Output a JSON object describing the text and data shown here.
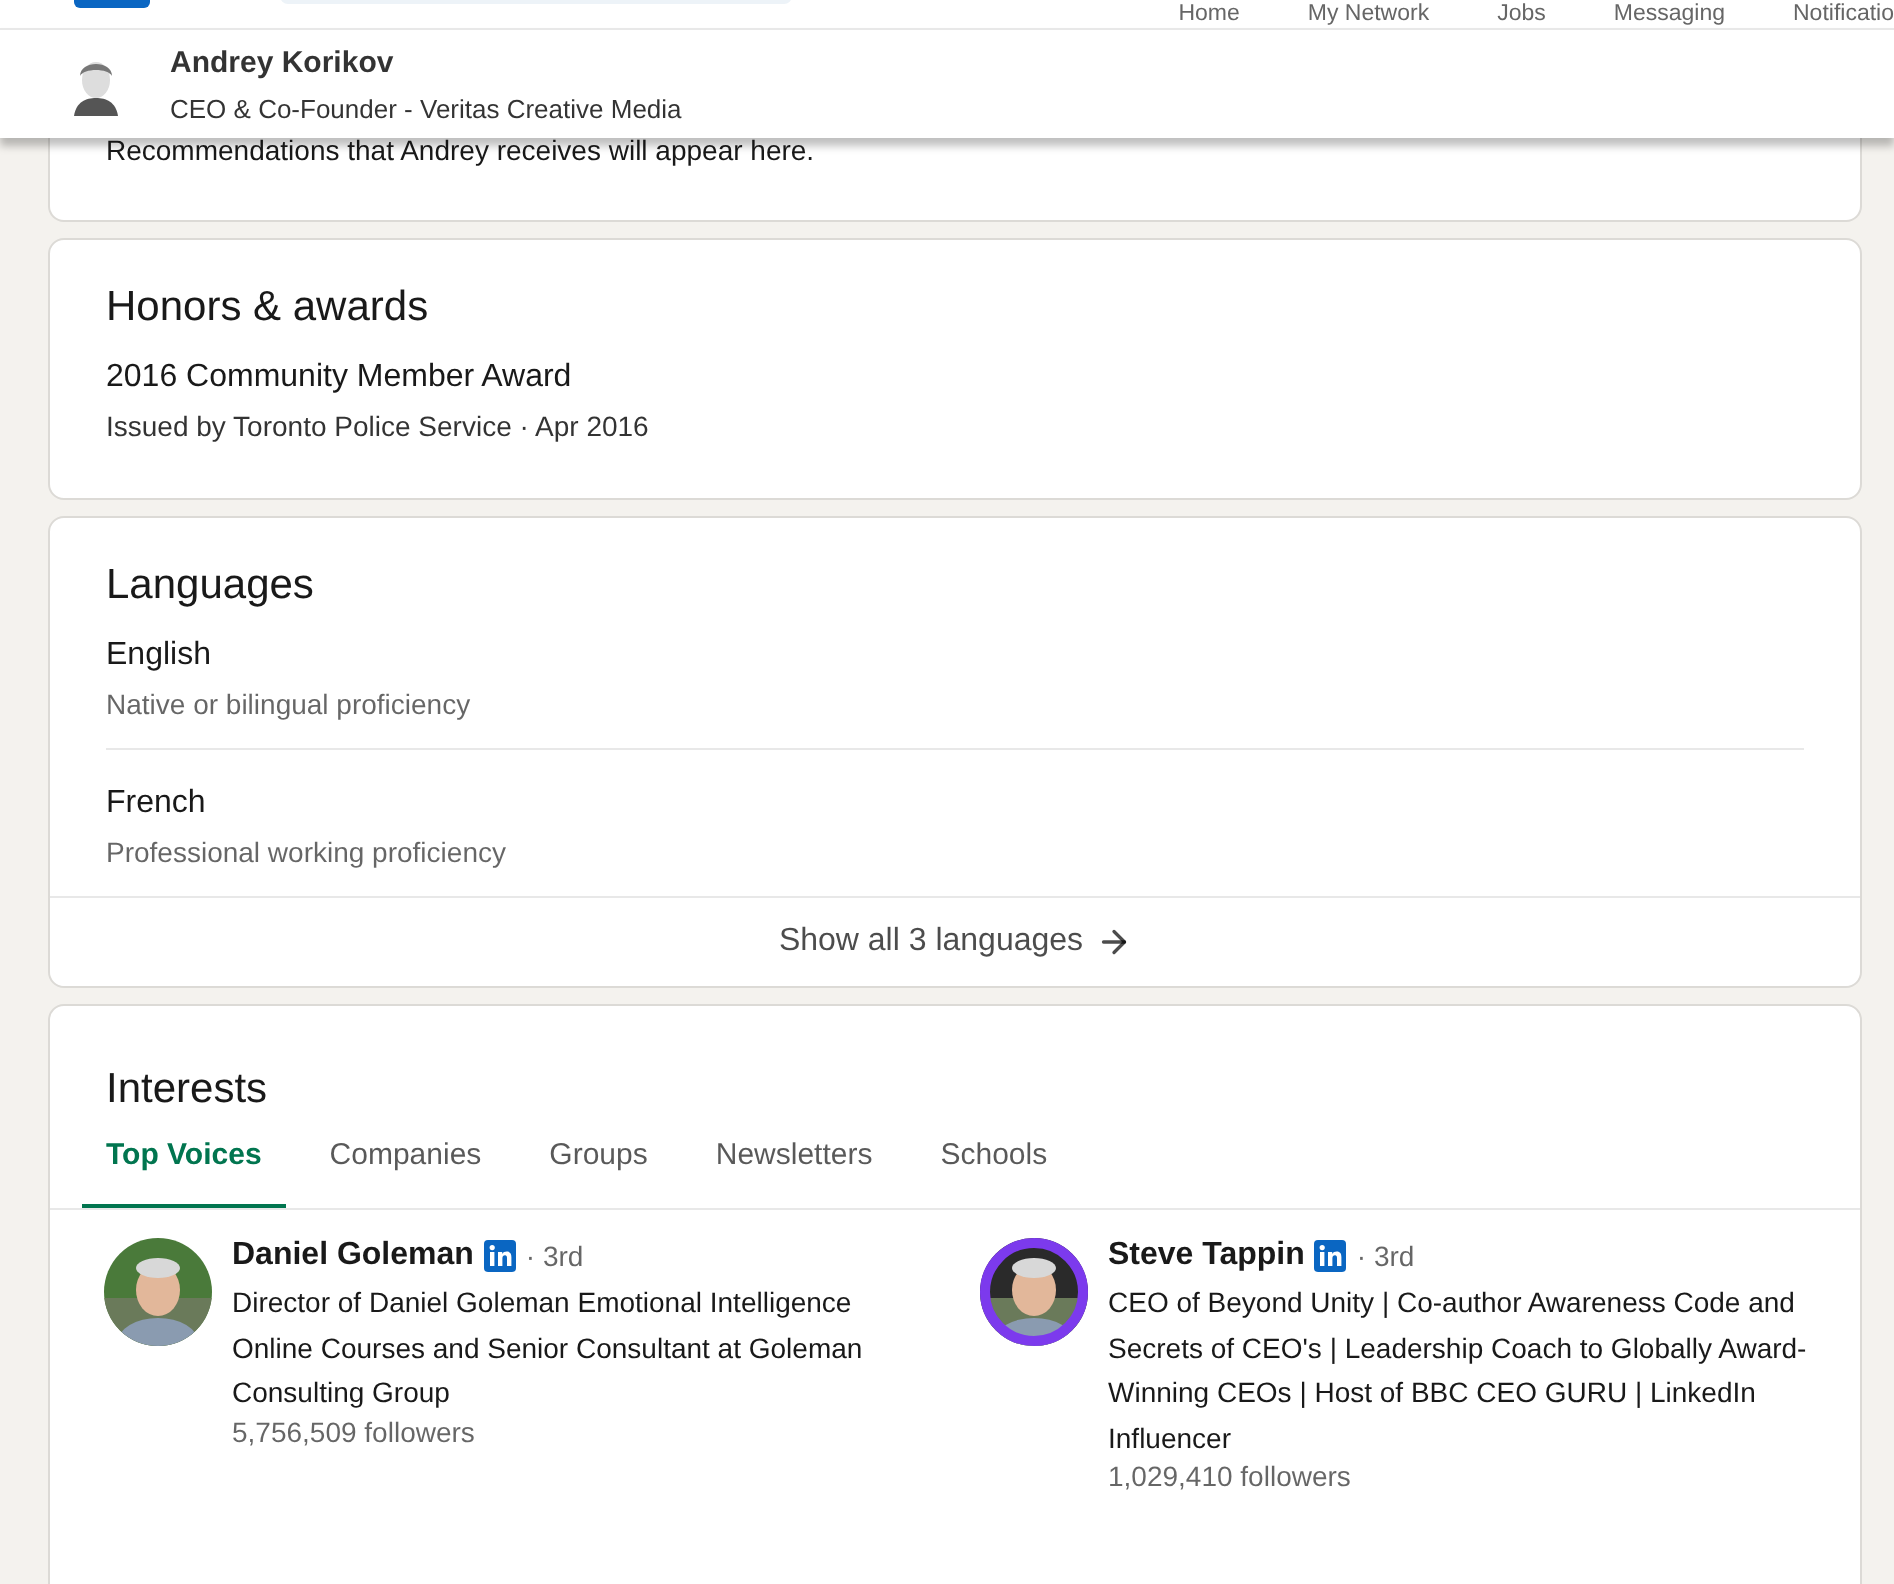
{
  "top_nav": {
    "items": [
      "Home",
      "My Network",
      "Jobs",
      "Messaging",
      "Notificatio"
    ]
  },
  "profile_header": {
    "name": "Andrey Korikov",
    "headline": "CEO & Co-Founder - Veritas Creative Media"
  },
  "recommendations": {
    "text": "Recommendations that Andrey receives will appear here."
  },
  "honors": {
    "title": "Honors & awards",
    "items": [
      {
        "name": "2016 Community Member Award",
        "detail": "Issued by Toronto Police Service · Apr 2016"
      }
    ]
  },
  "languages": {
    "title": "Languages",
    "items": [
      {
        "name": "English",
        "proficiency": "Native or bilingual proficiency"
      },
      {
        "name": "French",
        "proficiency": "Professional working proficiency"
      }
    ],
    "show_all": "Show all 3 languages"
  },
  "interests": {
    "title": "Interests",
    "tabs": [
      {
        "label": "Top Voices",
        "selected": true
      },
      {
        "label": "Companies",
        "selected": false
      },
      {
        "label": "Groups",
        "selected": false
      },
      {
        "label": "Newsletters",
        "selected": false
      },
      {
        "label": "Schools",
        "selected": false
      }
    ],
    "people": [
      {
        "name": "Daniel Goleman",
        "degree": "· 3rd",
        "headline": "Director of Daniel Goleman Emotional Intelligence Online Courses and Senior Consultant at Goleman Consulting Group",
        "followers": "5,756,509 followers",
        "hiring": false
      },
      {
        "name": "Steve Tappin",
        "degree": "· 3rd",
        "headline": "CEO of Beyond Unity | Co-author Awareness Code and Secrets of CEO's | Leadership Coach to Globally Award-Winning CEOs | Host of BBC CEO GURU | LinkedIn Influencer",
        "followers": "1,029,410 followers",
        "hiring": true
      }
    ]
  }
}
